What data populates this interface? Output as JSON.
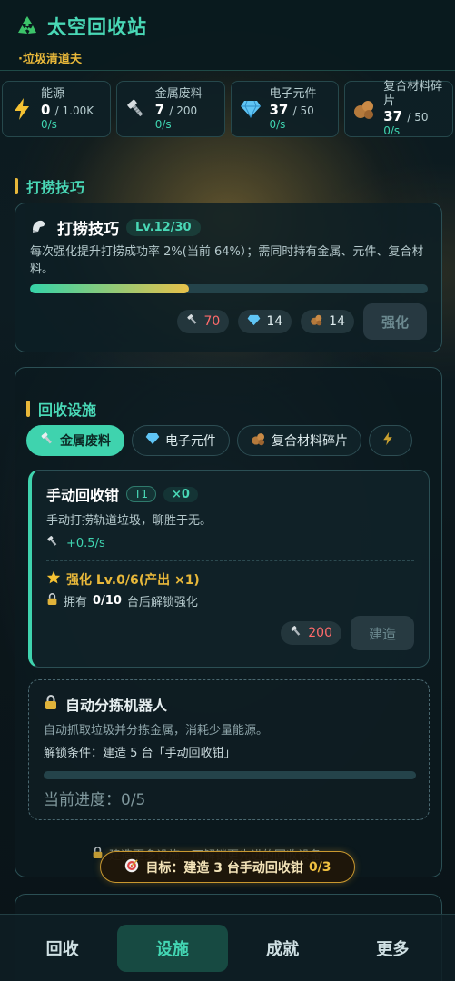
{
  "header": {
    "title": "太空回收站",
    "subtitle": "·垃圾清道夫"
  },
  "resources": [
    {
      "name": "能源",
      "amount": "0",
      "max": "/ 1.00K",
      "rate": "0/s",
      "icon": "lightning-icon"
    },
    {
      "name": "金属废料",
      "amount": "7",
      "max": "/ 200",
      "rate": "0/s",
      "icon": "screw-icon"
    },
    {
      "name": "电子元件",
      "amount": "37",
      "max": "/ 50",
      "rate": "0/s",
      "icon": "diamond-icon"
    },
    {
      "name": "复合材料碎片",
      "amount": "37",
      "max": "/ 50",
      "rate": "0/s",
      "icon": "rock-icon"
    }
  ],
  "skill_section": {
    "label": "打捞技巧",
    "card": {
      "title": "打捞技巧",
      "level": "Lv.12/30",
      "description": "每次强化提升打捞成功率 2%(当前 64%）；需同时持有金属、元件、复合材料。",
      "progress": 0.4,
      "costs": [
        {
          "value": "70",
          "icon": "screw-icon",
          "insufficient": true
        },
        {
          "value": "14",
          "icon": "diamond-icon",
          "insufficient": false
        },
        {
          "value": "14",
          "icon": "rock-icon",
          "insufficient": false
        }
      ],
      "button": "强化"
    }
  },
  "facilities": {
    "label": "回收设施",
    "tabs": [
      {
        "label": "金属废料",
        "icon": "screw-icon",
        "active": true
      },
      {
        "label": "电子元件",
        "icon": "diamond-icon",
        "active": false
      },
      {
        "label": "复合材料碎片",
        "icon": "rock-icon",
        "active": false
      },
      {
        "label": "",
        "icon": "lightning-icon",
        "active": false
      }
    ],
    "card": {
      "name": "手动回收钳",
      "tier": "T1",
      "count": "×0",
      "description": "手动打捞轨道垃圾，聊胜于无。",
      "rate": "+0.5/s",
      "upgrade": "强化 Lv.0/6(产出 ×1)",
      "unlock_prefix": "拥有",
      "unlock_count": "0/10",
      "unlock_suffix": "台后解锁强化",
      "cost": "200",
      "button": "建造"
    },
    "locked_card": {
      "name": "自动分拣机器人",
      "description": "自动抓取垃圾并分拣金属，消耗少量能源。",
      "condition": "解锁条件：建造 5 台「手动回收钳」",
      "progress_label": "当前进度：0/5",
      "progress": 0
    },
    "hint": "建造更多设施，可解锁更先进的回收设备"
  },
  "target": {
    "label": "目标：建造 3 台手动回收钳",
    "progress": "0/3"
  },
  "bottom_nav": [
    {
      "label": "回收",
      "active": false
    },
    {
      "label": "设施",
      "active": true
    },
    {
      "label": "成就",
      "active": false
    },
    {
      "label": "更多",
      "active": false
    }
  ],
  "colors": {
    "accent": "#3fd3ae",
    "gold": "#e8b83a",
    "danger": "#ff6b6b"
  }
}
